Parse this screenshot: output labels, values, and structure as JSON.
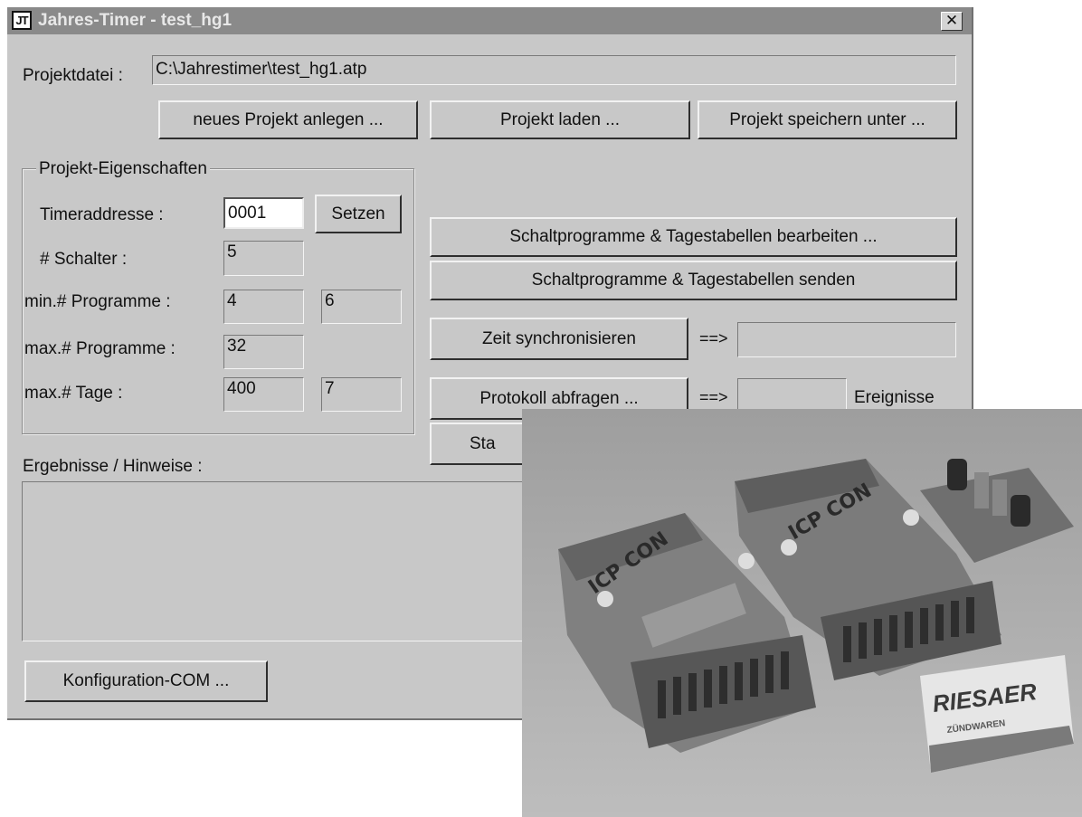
{
  "window": {
    "title": "Jahres-Timer - test_hg1",
    "icon_text": "JT",
    "close_symbol": "✕"
  },
  "project": {
    "file_label": "Projektdatei :",
    "file_path": "C:\\Jahrestimer\\test_hg1.atp",
    "btn_new": "neues Projekt anlegen ...",
    "btn_load": "Projekt laden ...",
    "btn_save_as": "Projekt speichern unter ..."
  },
  "properties": {
    "group_title": "Projekt-Eigenschaften",
    "timer_address_label": "Timeraddresse :",
    "timer_address_value": "0001",
    "set_button": "Setzen",
    "switches_label": "# Schalter :",
    "switches_value": "5",
    "min_programs_label": "min.# Programme :",
    "min_programs_value1": "4",
    "min_programs_value2": "6",
    "max_programs_label": "max.# Programme :",
    "max_programs_value": "32",
    "max_days_label": "max.# Tage :",
    "max_days_value1": "400",
    "max_days_value2": "7"
  },
  "actions": {
    "edit_programs": "Schaltprogramme & Tagestabellen bearbeiten ...",
    "send_programs": "Schaltprogramme & Tagestabellen senden",
    "sync_time": "Zeit synchronisieren",
    "sync_arrow": "==>",
    "sync_result": "",
    "query_log": "Protokoll abfragen ...",
    "log_arrow": "==>",
    "log_count": "",
    "events_label": "Ereignisse",
    "status_partial": "Sta"
  },
  "results": {
    "label": "Ergebnisse / Hinweise :",
    "text": ""
  },
  "config_button": "Konfiguration-COM ...",
  "photo": {
    "matchbox_brand": "RIESAER",
    "matchbox_sub": "ZÜNDWAREN",
    "module_brand": "ICP CON"
  }
}
